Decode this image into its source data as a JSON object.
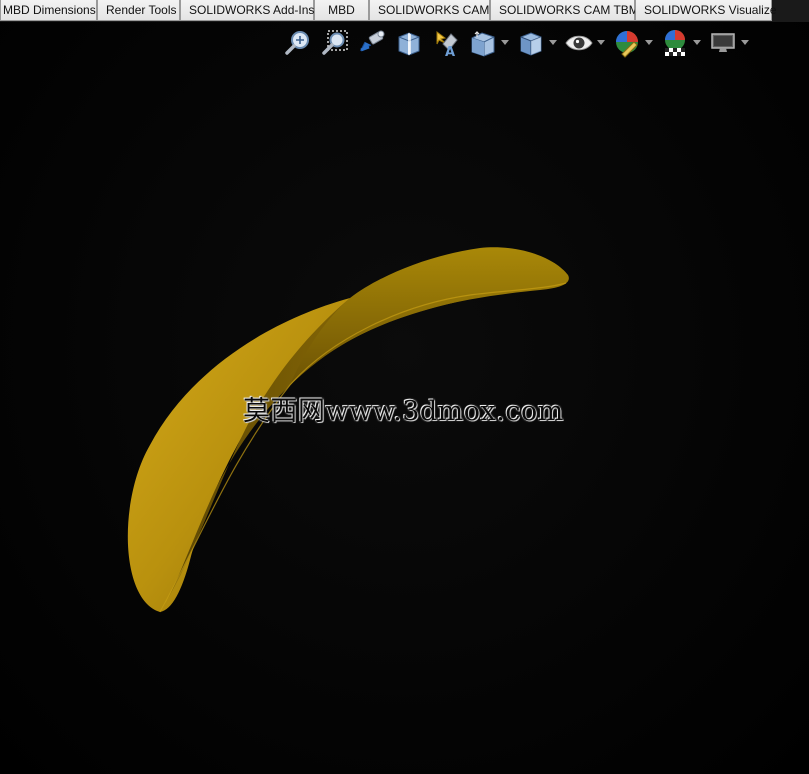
{
  "tabs": [
    {
      "label": "MBD Dimensions"
    },
    {
      "label": "Render Tools"
    },
    {
      "label": "SOLIDWORKS Add-Ins"
    },
    {
      "label": "MBD"
    },
    {
      "label": "SOLIDWORKS CAM"
    },
    {
      "label": "SOLIDWORKS CAM TBM"
    },
    {
      "label": "SOLIDWORKS Visualize"
    }
  ],
  "view_toolbar": [
    {
      "icon": "zoom-to-fit-icon"
    },
    {
      "icon": "zoom-to-area-icon"
    },
    {
      "icon": "previous-view-icon"
    },
    {
      "icon": "section-view-icon"
    },
    {
      "icon": "dynamic-annotation-views-icon"
    },
    {
      "icon": "view-orientation-icon"
    },
    {
      "icon": "display-style-icon"
    },
    {
      "icon": "hide-show-items-icon"
    },
    {
      "icon": "edit-appearance-icon"
    },
    {
      "icon": "apply-scene-icon"
    },
    {
      "icon": "view-settings-icon"
    }
  ],
  "viewport": {
    "background": "#000000",
    "model_color": "#b8930f",
    "watermark": "莫西网www.3dmox.com"
  }
}
